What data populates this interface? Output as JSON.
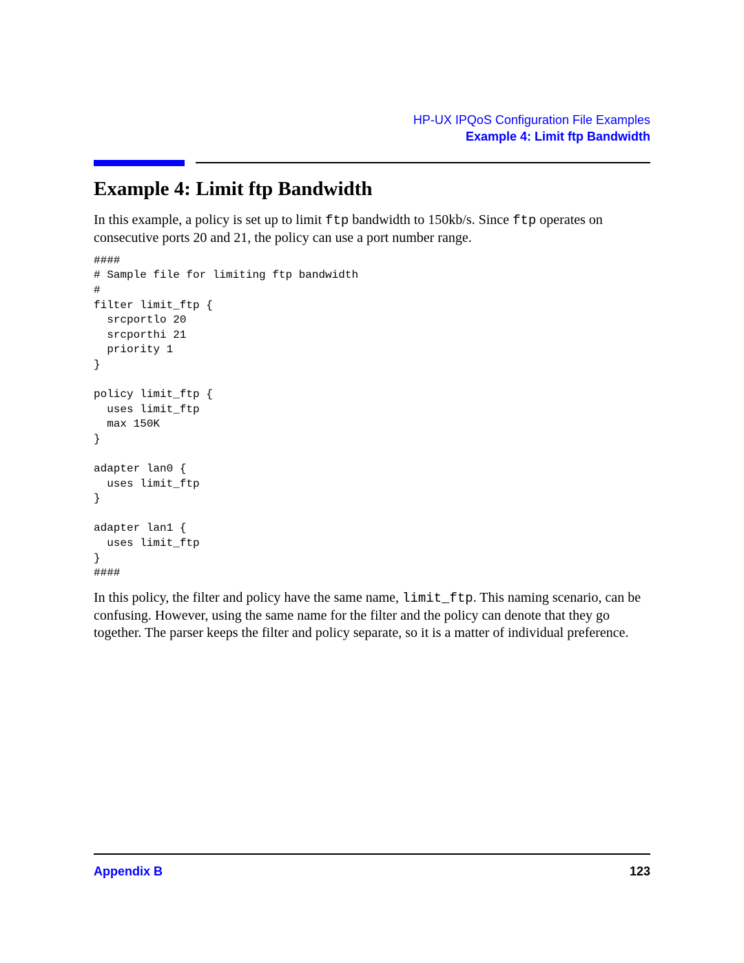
{
  "header": {
    "chapter": "HP-UX IPQoS Configuration File Examples",
    "section": "Example 4: Limit ftp Bandwidth"
  },
  "content": {
    "title": "Example 4: Limit ftp Bandwidth",
    "intro_a": "In this example, a policy is set up to limit ",
    "intro_code1": "ftp",
    "intro_b": " bandwidth to 150kb/s. Since ",
    "intro_code2": "ftp",
    "intro_c": " operates on consecutive ports 20 and 21, the policy can use a port number range.",
    "code": "####\n# Sample file for limiting ftp bandwidth\n#\nfilter limit_ftp {\n  srcportlo 20\n  srcporthi 21\n  priority 1\n}\n\npolicy limit_ftp {\n  uses limit_ftp\n  max 150K\n}\n\nadapter lan0 {\n  uses limit_ftp\n}\n\nadapter lan1 {\n  uses limit_ftp\n}\n####",
    "outro_a": "In this policy, the filter and policy have the same name, ",
    "outro_code": "limit_ftp",
    "outro_b": ". This naming scenario, can be confusing. However, using the same name for the filter and the policy can denote that they go together. The parser keeps the filter and policy separate, so it is a matter of individual preference."
  },
  "footer": {
    "left": "Appendix B",
    "right": "123"
  }
}
